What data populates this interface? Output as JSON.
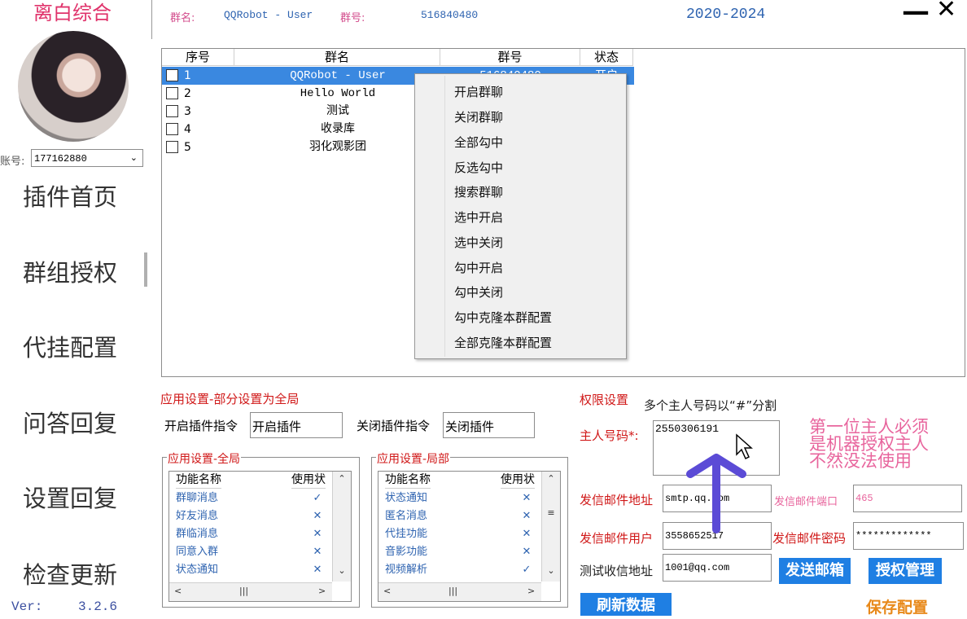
{
  "sidebar": {
    "app_title": "离白综合",
    "account_label": "账号:",
    "account_value": "177162880",
    "nav": [
      "插件首页",
      "群组授权",
      "代挂配置",
      "问答回复",
      "设置回复",
      "检查更新"
    ],
    "version_label": "Ver:",
    "version_value": "3.2.6"
  },
  "header": {
    "group_name_label": "群名:",
    "group_name_value": "QQRobot - User",
    "group_id_label": "群号:",
    "group_id_value": "516840480",
    "years": "2020-2024",
    "minimize_glyph": "—",
    "close_glyph": "✕"
  },
  "group_table": {
    "columns": [
      "序号",
      "群名",
      "群号",
      "状态"
    ],
    "rows": [
      {
        "index": "1",
        "name": "QQRobot - User",
        "id": "516840480",
        "status": "开启",
        "selected": true
      },
      {
        "index": "2",
        "name": "Hello World",
        "id": "",
        "status": "",
        "selected": false
      },
      {
        "index": "3",
        "name": "测试",
        "id": "",
        "status": "",
        "selected": false
      },
      {
        "index": "4",
        "name": "收录库",
        "id": "",
        "status": "",
        "selected": false
      },
      {
        "index": "5",
        "name": "羽化观影团",
        "id": "",
        "status": "",
        "selected": false
      }
    ]
  },
  "context_menu": {
    "items": [
      "开启群聊",
      "关闭群聊",
      "全部勾中",
      "反选勾中",
      "搜索群聊",
      "选中开启",
      "选中关闭",
      "勾中开启",
      "勾中关闭",
      "勾中克隆本群配置",
      "全部克隆本群配置"
    ]
  },
  "app_settings": {
    "title": "应用设置-部分设置为全局",
    "enable_cmd_label": "开启插件指令",
    "enable_cmd_value": "开启插件",
    "disable_cmd_label": "关闭插件指令",
    "disable_cmd_value": "关闭插件",
    "global": {
      "title": "应用设置-全局",
      "col_name": "功能名称",
      "col_status": "使用状",
      "rows": [
        {
          "name": "群聊消息",
          "mark": "✓"
        },
        {
          "name": "好友消息",
          "mark": "✕"
        },
        {
          "name": "群临消息",
          "mark": "✕"
        },
        {
          "name": "同意入群",
          "mark": "✕"
        },
        {
          "name": "状态通知",
          "mark": "✕"
        }
      ]
    },
    "local": {
      "title": "应用设置-局部",
      "col_name": "功能名称",
      "col_status": "使用状",
      "rows": [
        {
          "name": "状态通知",
          "mark": "✕"
        },
        {
          "name": "匿名消息",
          "mark": "✕"
        },
        {
          "name": "代挂功能",
          "mark": "✕"
        },
        {
          "name": "音影功能",
          "mark": "✕"
        },
        {
          "name": "视频解析",
          "mark": "✓"
        }
      ]
    }
  },
  "permissions": {
    "title": "权限设置",
    "hint": "多个主人号码以“#”分割",
    "owner_label": "主人号码*:",
    "owner_value": "2550306191",
    "warning_lines": [
      "第一位主人必须",
      "是机器授权主人",
      "不然没法使用"
    ],
    "mail_addr_label": "发信邮件地址",
    "mail_addr_value": "smtp.qq.com",
    "mail_port_label": "发信邮件端口",
    "mail_port_value": "465",
    "mail_user_label": "发信邮件用户",
    "mail_user_value": "3558652517",
    "mail_pass_label": "发信邮件密码",
    "mail_pass_value": "*************",
    "test_addr_label": "测试收信地址",
    "test_addr_value": "1001@qq.com",
    "send_mail_button": "发送邮箱",
    "auth_manage_button": "授权管理",
    "refresh_button": "刷新数据",
    "save_button": "保存配置"
  },
  "colors": {
    "accent_pink": "#e0336b",
    "label_red": "#d01818",
    "link_blue": "#2e63b0",
    "button_blue": "#1f7fe3",
    "selection_blue": "#3a88e0",
    "save_orange": "#e8891a",
    "arrow_purple": "#5b4bd6"
  }
}
